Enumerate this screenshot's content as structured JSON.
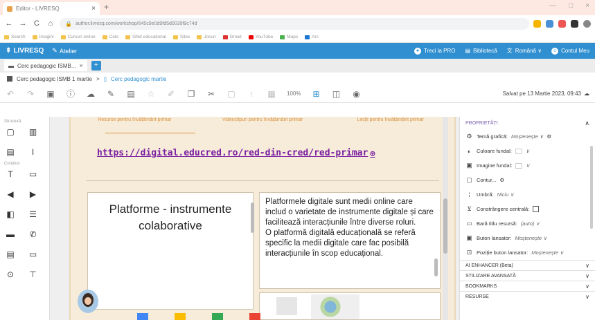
{
  "browser": {
    "tab_title": "Editor - LIVRESQ",
    "tab_close": "×",
    "new_tab": "+",
    "window_controls": [
      "—",
      "□",
      "×"
    ],
    "nav": [
      "←",
      "→",
      "C",
      "⌂"
    ],
    "url": "author.livresq.com/workshop/645c9e0d9fd5d0039f9c74d",
    "bookmarks": [
      "Search",
      "Imagini",
      "Cursuri online",
      "Cele",
      "Ghid educațional",
      "Sites",
      "Jocuri",
      "Gmail",
      "YouTube",
      "Maps",
      "Arc"
    ]
  },
  "app": {
    "logo": "LIVRESQ",
    "atelier": "Atelier",
    "header_right": [
      {
        "label": "Treci la PRO",
        "icon": "circle-icon"
      },
      {
        "label": "Bibliotecă",
        "icon": "library-icon"
      },
      {
        "label": "Română ∨",
        "icon": "translate-icon"
      },
      {
        "label": "Contul Meu",
        "icon": "account-icon"
      }
    ]
  },
  "doc_tabs": [
    {
      "label": "Cerc pedagogic ISMB... ",
      "close": "×"
    }
  ],
  "add_tab": "+",
  "breadcrumb": {
    "root": "Cerc pedagogic ISMB 1 martie",
    "sep": ">",
    "current": "Cerc pedagogic martie"
  },
  "toolbar": {
    "zoom": "100%",
    "saved": "Salvat pe 13 Martie 2023, 09:43"
  },
  "left_panel": {
    "structure_label": "Structură",
    "content_label": "Conținut"
  },
  "page": {
    "subtabs": [
      "Resurse pentru învățământ primar",
      "Videoclipuri pentru învățământ primar",
      "Lecții pentru învățământ primar"
    ],
    "link": "https://digital.educred.ro/red-din-cred/red-primar",
    "title_box": "Platforme - instrumente colaborative",
    "text_box": "Platformele digitale sunt medii online care includ o varietate de instrumente digitale și care facilitează interacțiunile între diverse roluri.\nO platformă digitală educațională se referă specific la medii digitale care fac posibilă interacțiunile în scop educațional."
  },
  "properties": {
    "header": "PROPRIETĂȚI",
    "rows": [
      {
        "label": "Temă grafică:",
        "value": "Moștenește ∨",
        "icon": "palette-icon"
      },
      {
        "label": "Culoare fundal:",
        "value": "∨",
        "icon": "color-icon"
      },
      {
        "label": "Imagine fundal:",
        "value": "∨",
        "icon": "image-icon"
      },
      {
        "label": "Contur...",
        "value": "",
        "icon": "border-icon"
      },
      {
        "label": "Umbră:",
        "value": "Niciu ∨",
        "icon": "shadow-icon"
      },
      {
        "label": "Constrângere centrală:",
        "value": "",
        "icon": "center-icon"
      },
      {
        "label": "Bară titlu resursă:",
        "value": "(auto) ∨",
        "icon": "titlebar-icon"
      },
      {
        "label": "Buton lansator:",
        "value": "Moștenește ∨",
        "icon": "launcher-icon"
      },
      {
        "label": "Poziție buton lansator:",
        "value": "Moștenește ∨",
        "icon": "position-icon"
      }
    ],
    "sections": [
      "AI ENHANCER (Beta)",
      "STILIZARE AVANSATĂ",
      "BOOKMARKS",
      "RESURSE"
    ]
  }
}
